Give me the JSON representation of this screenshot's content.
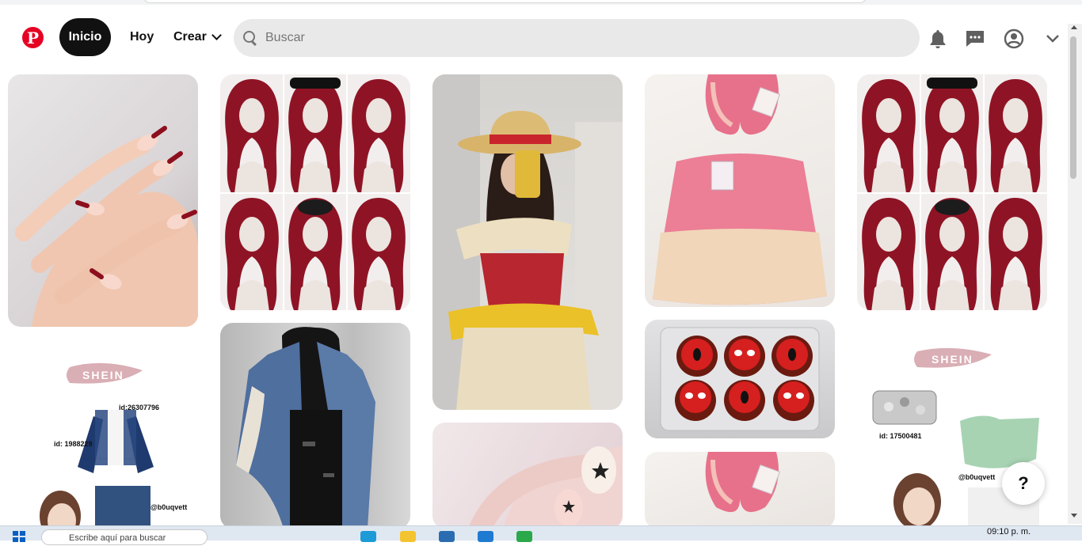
{
  "header": {
    "logo_text": "P",
    "nav_home": "Inicio",
    "nav_today": "Hoy",
    "nav_create": "Crear",
    "search_placeholder": "Buscar"
  },
  "pins": {
    "shein1": {
      "brand": "SHEIN",
      "id_a": "id:26307796",
      "id_b": "id: 1988229",
      "handle": "@b0uqvett"
    },
    "shein2": {
      "brand": "SHEIN",
      "id_a": "id: 17500481",
      "handle": "@b0uqvett"
    }
  },
  "help_label": "?",
  "taskbar": {
    "search_placeholder": "Escribe aquí para buscar",
    "clock": "09:10 p. m."
  },
  "colors": {
    "brand": "#e60023",
    "active_nav": "#111111",
    "search_bg": "#e9e9e9"
  }
}
